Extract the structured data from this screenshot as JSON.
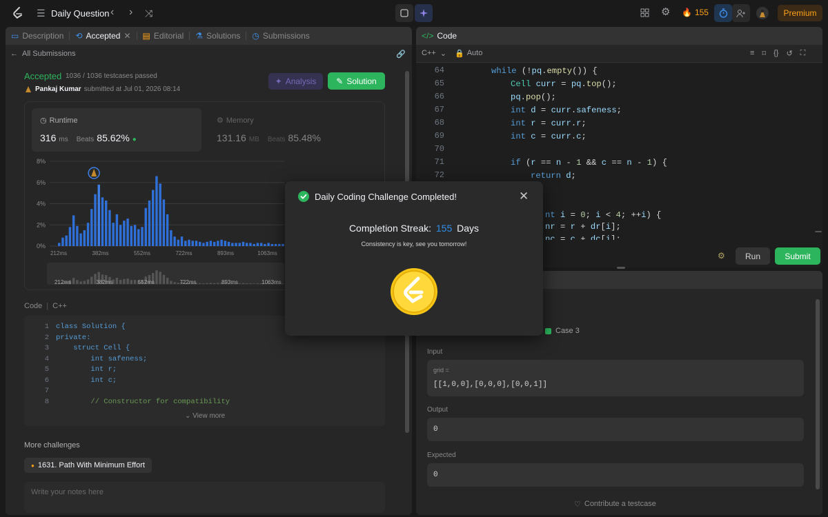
{
  "topbar": {
    "title": "Daily Question",
    "streak_count": "155",
    "premium_label": "Premium"
  },
  "left_tabs": [
    {
      "label": "Description"
    },
    {
      "label": "Accepted"
    },
    {
      "label": "Editorial"
    },
    {
      "label": "Solutions"
    },
    {
      "label": "Submissions"
    }
  ],
  "submission": {
    "back_label": "All Submissions",
    "status": "Accepted",
    "testcases": "1036 / 1036 testcases passed",
    "user": "Pankaj Kumar",
    "submitted": "submitted at Jul 01, 2026 08:14",
    "analysis_label": "Analysis",
    "solution_label": "Solution"
  },
  "runtime": {
    "label": "Runtime",
    "value": "316",
    "unit": "ms",
    "beats_label": "Beats",
    "beats": "85.62%"
  },
  "memory": {
    "label": "Memory",
    "value": "131.16",
    "unit": "MB",
    "beats_label": "Beats",
    "beats": "85.48%"
  },
  "chart_data": {
    "type": "bar",
    "y_ticks": [
      "8%",
      "6%",
      "4%",
      "2%",
      "0%"
    ],
    "x_ticks": [
      "212ms",
      "382ms",
      "552ms",
      "722ms",
      "893ms",
      "1063ms"
    ],
    "ylim": [
      0,
      8
    ],
    "values": [
      0.3,
      0.8,
      1.0,
      1.8,
      2.9,
      1.9,
      1.2,
      1.5,
      2.2,
      3.5,
      4.9,
      5.8,
      4.6,
      4.3,
      3.4,
      2.2,
      3.0,
      2.0,
      2.4,
      2.6,
      1.9,
      2.0,
      1.6,
      1.8,
      3.6,
      4.3,
      5.3,
      6.6,
      5.9,
      4.4,
      3.0,
      1.5,
      0.9,
      0.6,
      0.9,
      0.5,
      0.6,
      0.5,
      0.5,
      0.4,
      0.3,
      0.4,
      0.5,
      0.4,
      0.5,
      0.6,
      0.5,
      0.4,
      0.3,
      0.3,
      0.3,
      0.4,
      0.3,
      0.3,
      0.2,
      0.3,
      0.3,
      0.2,
      0.3,
      0.2,
      0.2,
      0.2,
      0.2,
      0.2,
      0.1
    ],
    "highlight_index": 11
  },
  "code_preview": {
    "label": "Code",
    "lang": "C++",
    "lines": [
      {
        "n": "1",
        "text": "class Solution {"
      },
      {
        "n": "2",
        "text": "private:"
      },
      {
        "n": "3",
        "text": "    struct Cell {"
      },
      {
        "n": "4",
        "text": "        int safeness;"
      },
      {
        "n": "5",
        "text": "        int r;"
      },
      {
        "n": "6",
        "text": "        int c;"
      },
      {
        "n": "7",
        "text": ""
      },
      {
        "n": "8",
        "text": "        // Constructor for compatibility"
      }
    ],
    "view_more": "View more"
  },
  "more_challenges": {
    "label": "More challenges",
    "item": "1631. Path With Minimum Effort"
  },
  "notes_placeholder": "Write your notes here",
  "editor": {
    "tab_label": "Code",
    "lang": "C++",
    "mode": "Auto",
    "run_label": "Run",
    "submit_label": "Submit"
  },
  "editor_lines": [
    "64",
    "65",
    "66",
    "67",
    "68",
    "69",
    "70",
    "71",
    "72"
  ],
  "testcase": {
    "case_label": "Case 3",
    "input_label": "Input",
    "param": "grid =",
    "input_value": "[[1,0,0],[0,0,0],[0,0,1]]",
    "output_label": "Output",
    "output_value": "0",
    "expected_label": "Expected",
    "expected_value": "0",
    "contribute_label": "Contribute a testcase"
  },
  "modal": {
    "title": "Daily Coding Challenge Completed!",
    "streak_label": "Completion Streak:",
    "streak_value": "155",
    "streak_unit": "Days",
    "subtitle": "Consistency is key, see you tomorrow!"
  },
  "colors": {
    "accent_green": "#2db55d",
    "accent_orange": "#ffa116",
    "bar_blue": "#2f6fd8",
    "streak_blue": "#2f8fe8"
  }
}
